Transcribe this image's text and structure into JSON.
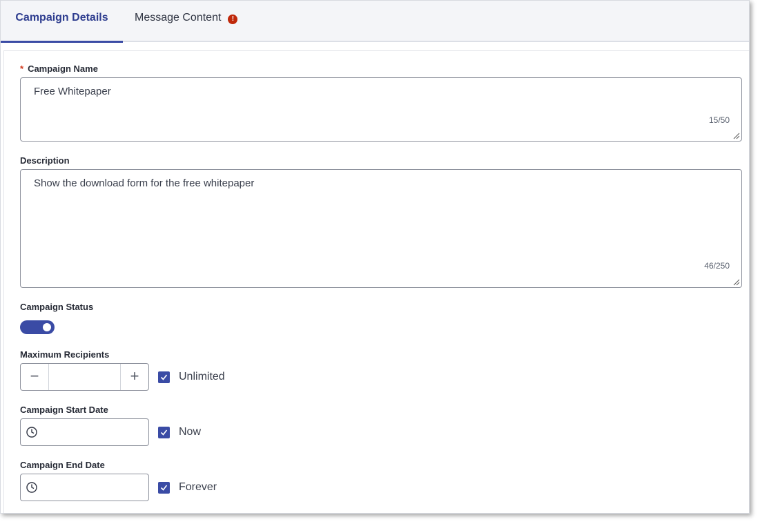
{
  "tabs": {
    "campaign_details": "Campaign Details",
    "message_content": "Message Content",
    "message_content_alert": "!"
  },
  "form": {
    "required_marker": "*",
    "campaign_name": {
      "label": "Campaign Name",
      "value": "Free Whitepaper",
      "counter": "15/50"
    },
    "description": {
      "label": "Description",
      "value": "Show the download form for the free whitepaper",
      "counter": "46/250"
    },
    "campaign_status": {
      "label": "Campaign Status",
      "enabled": true
    },
    "max_recipients": {
      "label": "Maximum Recipients",
      "value": "",
      "minus": "−",
      "plus": "+",
      "unlimited_label": "Unlimited",
      "unlimited_checked": true
    },
    "start_date": {
      "label": "Campaign Start Date",
      "value": "",
      "now_label": "Now",
      "now_checked": true
    },
    "end_date": {
      "label": "Campaign End Date",
      "value": "",
      "forever_label": "Forever",
      "forever_checked": true
    }
  },
  "colors": {
    "accent": "#3a4ba5",
    "required": "#d1391d",
    "alert": "#c0290b",
    "tab_background": "#f4f5f8"
  },
  "icons": [
    "alert-icon",
    "resize-handle-icon",
    "minus-icon",
    "plus-icon",
    "clock-icon",
    "checkmark-icon"
  ]
}
